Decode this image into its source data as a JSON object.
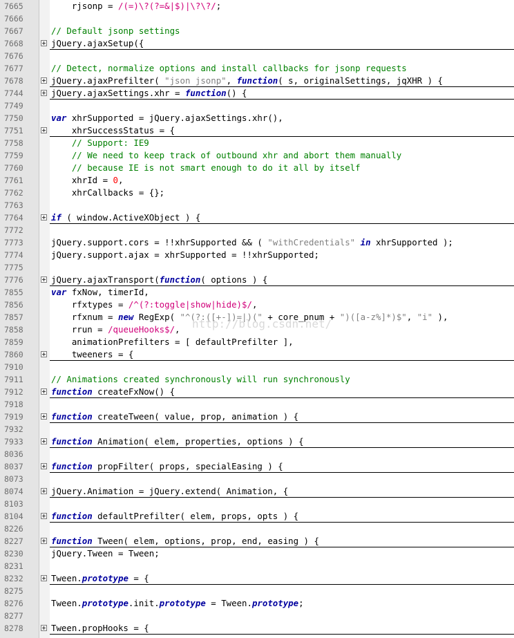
{
  "editor": {
    "watermark": "http://blog.csdn.net/",
    "lines": [
      {
        "n": "7665",
        "fold": false,
        "hidden": false,
        "segs": [
          [
            "t",
            "    rjsonp = "
          ],
          [
            "re",
            "/(=)\\?(?=&|$)|\\?\\?/"
          ],
          [
            "t",
            ";"
          ]
        ]
      },
      {
        "n": "7666",
        "fold": false,
        "hidden": false,
        "segs": []
      },
      {
        "n": "7667",
        "fold": false,
        "hidden": false,
        "segs": [
          [
            "cm",
            "// Default jsonp settings"
          ]
        ]
      },
      {
        "n": "7668",
        "fold": true,
        "hidden": true,
        "segs": [
          [
            "t",
            "jQuery.ajaxSetup({"
          ]
        ]
      },
      {
        "n": "7676",
        "fold": false,
        "hidden": false,
        "segs": []
      },
      {
        "n": "7677",
        "fold": false,
        "hidden": false,
        "segs": [
          [
            "cm",
            "// Detect, normalize options and install callbacks for jsonp requests"
          ]
        ]
      },
      {
        "n": "7678",
        "fold": true,
        "hidden": true,
        "segs": [
          [
            "t",
            "jQuery.ajaxPrefilter( "
          ],
          [
            "str",
            "\"json jsonp\""
          ],
          [
            "t",
            ", "
          ],
          [
            "kw",
            "function"
          ],
          [
            "t",
            "( s, originalSettings, jqXHR ) {"
          ]
        ]
      },
      {
        "n": "7744",
        "fold": true,
        "hidden": true,
        "segs": [
          [
            "t",
            "jQuery.ajaxSettings.xhr = "
          ],
          [
            "kw",
            "function"
          ],
          [
            "t",
            "() {"
          ]
        ]
      },
      {
        "n": "7749",
        "fold": false,
        "hidden": false,
        "segs": []
      },
      {
        "n": "7750",
        "fold": false,
        "hidden": false,
        "segs": [
          [
            "kw",
            "var"
          ],
          [
            "t",
            " xhrSupported = jQuery.ajaxSettings.xhr(),"
          ]
        ]
      },
      {
        "n": "7751",
        "fold": true,
        "hidden": true,
        "segs": [
          [
            "t",
            "    xhrSuccessStatus = {"
          ]
        ]
      },
      {
        "n": "7758",
        "fold": false,
        "hidden": false,
        "segs": [
          [
            "t",
            "    "
          ],
          [
            "cm",
            "// Support: IE9"
          ]
        ]
      },
      {
        "n": "7759",
        "fold": false,
        "hidden": false,
        "segs": [
          [
            "t",
            "    "
          ],
          [
            "cm",
            "// We need to keep track of outbound xhr and abort them manually"
          ]
        ]
      },
      {
        "n": "7760",
        "fold": false,
        "hidden": false,
        "segs": [
          [
            "t",
            "    "
          ],
          [
            "cm",
            "// because IE is not smart enough to do it all by itself"
          ]
        ]
      },
      {
        "n": "7761",
        "fold": false,
        "hidden": false,
        "segs": [
          [
            "t",
            "    xhrId = "
          ],
          [
            "num",
            "0"
          ],
          [
            "t",
            ","
          ]
        ]
      },
      {
        "n": "7762",
        "fold": false,
        "hidden": false,
        "segs": [
          [
            "t",
            "    xhrCallbacks = {};"
          ]
        ]
      },
      {
        "n": "7763",
        "fold": false,
        "hidden": false,
        "segs": []
      },
      {
        "n": "7764",
        "fold": true,
        "hidden": true,
        "segs": [
          [
            "kw",
            "if"
          ],
          [
            "t",
            " ( window.ActiveXObject ) {"
          ]
        ]
      },
      {
        "n": "7772",
        "fold": false,
        "hidden": false,
        "segs": []
      },
      {
        "n": "7773",
        "fold": false,
        "hidden": false,
        "segs": [
          [
            "t",
            "jQuery.support.cors = !!xhrSupported && ( "
          ],
          [
            "str",
            "\"withCredentials\""
          ],
          [
            "t",
            " "
          ],
          [
            "kw",
            "in"
          ],
          [
            "t",
            " xhrSupported );"
          ]
        ]
      },
      {
        "n": "7774",
        "fold": false,
        "hidden": false,
        "segs": [
          [
            "t",
            "jQuery.support.ajax = xhrSupported = !!xhrSupported;"
          ]
        ]
      },
      {
        "n": "7775",
        "fold": false,
        "hidden": false,
        "segs": []
      },
      {
        "n": "7776",
        "fold": true,
        "hidden": true,
        "segs": [
          [
            "t",
            "jQuery.ajaxTransport("
          ],
          [
            "kw",
            "function"
          ],
          [
            "t",
            "( options ) {"
          ]
        ]
      },
      {
        "n": "7855",
        "fold": false,
        "hidden": false,
        "segs": [
          [
            "kw",
            "var"
          ],
          [
            "t",
            " fxNow, timerId,"
          ]
        ]
      },
      {
        "n": "7856",
        "fold": false,
        "hidden": false,
        "segs": [
          [
            "t",
            "    rfxtypes = "
          ],
          [
            "re",
            "/^(?:toggle|show|hide)$/"
          ],
          [
            "t",
            ","
          ]
        ]
      },
      {
        "n": "7857",
        "fold": false,
        "hidden": false,
        "segs": [
          [
            "t",
            "    rfxnum = "
          ],
          [
            "kw",
            "new"
          ],
          [
            "t",
            " RegExp( "
          ],
          [
            "str",
            "\"^(?:([+-])=|)(\""
          ],
          [
            "t",
            " + core_pnum + "
          ],
          [
            "str",
            "\")([a-z%]*)$\""
          ],
          [
            "t",
            ", "
          ],
          [
            "str",
            "\"i\""
          ],
          [
            "t",
            " ),"
          ]
        ]
      },
      {
        "n": "7858",
        "fold": false,
        "hidden": false,
        "segs": [
          [
            "t",
            "    rrun = "
          ],
          [
            "re",
            "/queueHooks$/"
          ],
          [
            "t",
            ","
          ]
        ]
      },
      {
        "n": "7859",
        "fold": false,
        "hidden": false,
        "segs": [
          [
            "t",
            "    animationPrefilters = [ defaultPrefilter ],"
          ]
        ]
      },
      {
        "n": "7860",
        "fold": true,
        "hidden": true,
        "segs": [
          [
            "t",
            "    tweeners = {"
          ]
        ]
      },
      {
        "n": "7910",
        "fold": false,
        "hidden": false,
        "segs": []
      },
      {
        "n": "7911",
        "fold": false,
        "hidden": false,
        "segs": [
          [
            "cm",
            "// Animations created synchronously will run synchronously"
          ]
        ]
      },
      {
        "n": "7912",
        "fold": true,
        "hidden": true,
        "segs": [
          [
            "kw",
            "function"
          ],
          [
            "t",
            " createFxNow() {"
          ]
        ]
      },
      {
        "n": "7918",
        "fold": false,
        "hidden": false,
        "segs": []
      },
      {
        "n": "7919",
        "fold": true,
        "hidden": true,
        "segs": [
          [
            "kw",
            "function"
          ],
          [
            "t",
            " createTween( value, prop, animation ) {"
          ]
        ]
      },
      {
        "n": "7932",
        "fold": false,
        "hidden": false,
        "segs": []
      },
      {
        "n": "7933",
        "fold": true,
        "hidden": true,
        "segs": [
          [
            "kw",
            "function"
          ],
          [
            "t",
            " Animation( elem, properties, options ) {"
          ]
        ]
      },
      {
        "n": "8036",
        "fold": false,
        "hidden": false,
        "segs": []
      },
      {
        "n": "8037",
        "fold": true,
        "hidden": true,
        "segs": [
          [
            "kw",
            "function"
          ],
          [
            "t",
            " propFilter( props, specialEasing ) {"
          ]
        ]
      },
      {
        "n": "8073",
        "fold": false,
        "hidden": false,
        "segs": []
      },
      {
        "n": "8074",
        "fold": true,
        "hidden": true,
        "segs": [
          [
            "t",
            "jQuery.Animation = jQuery.extend( Animation, {"
          ]
        ]
      },
      {
        "n": "8103",
        "fold": false,
        "hidden": false,
        "segs": []
      },
      {
        "n": "8104",
        "fold": true,
        "hidden": true,
        "segs": [
          [
            "kw",
            "function"
          ],
          [
            "t",
            " defaultPrefilter( elem, props, opts ) {"
          ]
        ]
      },
      {
        "n": "8226",
        "fold": false,
        "hidden": false,
        "segs": []
      },
      {
        "n": "8227",
        "fold": true,
        "hidden": true,
        "segs": [
          [
            "kw",
            "function"
          ],
          [
            "t",
            " Tween( elem, options, prop, end, easing ) {"
          ]
        ]
      },
      {
        "n": "8230",
        "fold": false,
        "hidden": false,
        "segs": [
          [
            "t",
            "jQuery.Tween = Tween;"
          ]
        ]
      },
      {
        "n": "8231",
        "fold": false,
        "hidden": false,
        "segs": []
      },
      {
        "n": "8232",
        "fold": true,
        "hidden": true,
        "segs": [
          [
            "t",
            "Tween."
          ],
          [
            "kw",
            "prototype"
          ],
          [
            "t",
            " = {"
          ]
        ]
      },
      {
        "n": "8275",
        "fold": false,
        "hidden": false,
        "segs": []
      },
      {
        "n": "8276",
        "fold": false,
        "hidden": false,
        "segs": [
          [
            "t",
            "Tween."
          ],
          [
            "kw",
            "prototype"
          ],
          [
            "t",
            ".init."
          ],
          [
            "kw",
            "prototype"
          ],
          [
            "t",
            " = Tween."
          ],
          [
            "kw",
            "prototype"
          ],
          [
            "t",
            ";"
          ]
        ]
      },
      {
        "n": "8277",
        "fold": false,
        "hidden": false,
        "segs": []
      },
      {
        "n": "8278",
        "fold": true,
        "hidden": true,
        "segs": [
          [
            "t",
            "Tween.propHooks = {"
          ]
        ]
      }
    ]
  }
}
